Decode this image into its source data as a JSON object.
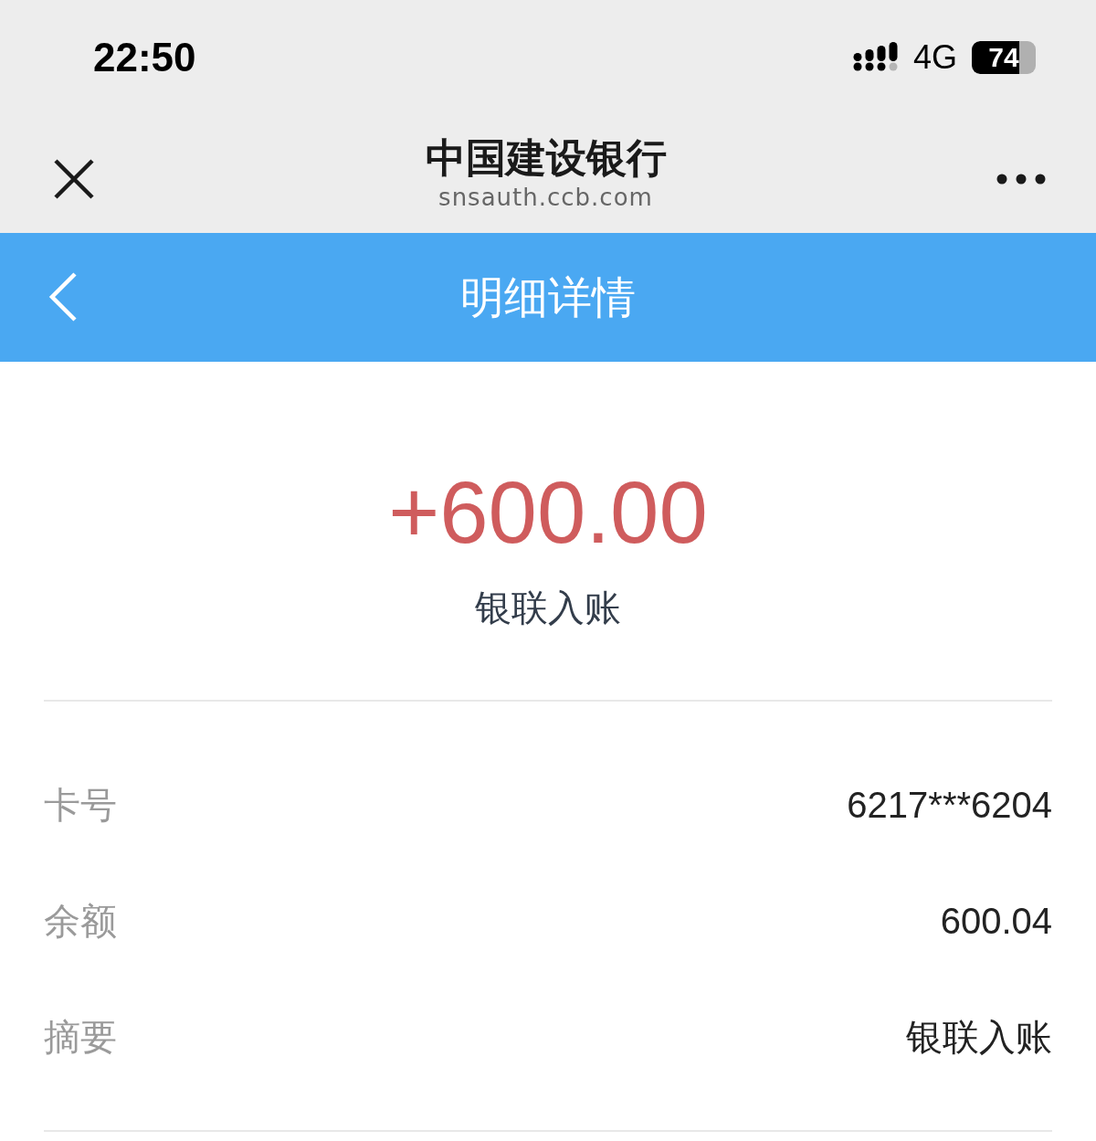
{
  "status_bar": {
    "time": "22:50",
    "network": "4G",
    "battery": "74"
  },
  "browser_header": {
    "title": "中国建设银行",
    "url": "snsauth.ccb.com"
  },
  "nav_bar": {
    "title": "明细详情"
  },
  "transaction": {
    "amount": "+600.00",
    "type": "银联入账"
  },
  "details": [
    {
      "label": "卡号",
      "value": "6217***6204"
    },
    {
      "label": "余额",
      "value": "600.04"
    },
    {
      "label": "摘要",
      "value": "银联入账"
    }
  ]
}
